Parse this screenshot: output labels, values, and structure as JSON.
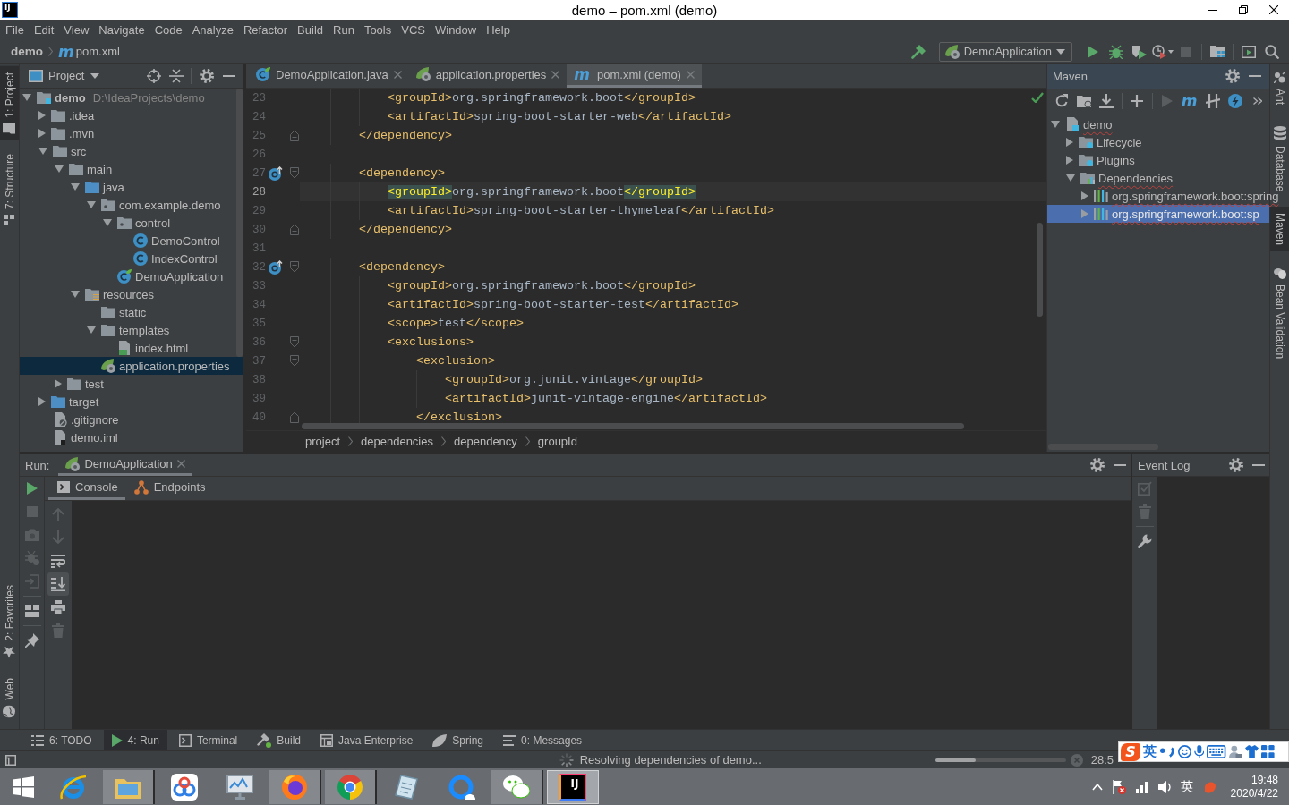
{
  "window": {
    "app_logo": "IJ",
    "title": "demo – pom.xml (demo)"
  },
  "menu": [
    "File",
    "Edit",
    "View",
    "Navigate",
    "Code",
    "Analyze",
    "Refactor",
    "Build",
    "Run",
    "Tools",
    "VCS",
    "Window",
    "Help"
  ],
  "nav_bar": {
    "project": "demo",
    "file_icon": "m",
    "file": "pom.xml"
  },
  "toolbar": {
    "build": {
      "disabled": false
    },
    "run_config": "DemoApplication",
    "groups": [
      [
        {
          "kind": "run",
          "disabled": false
        },
        {
          "kind": "debug",
          "disabled": false
        },
        {
          "kind": "coverage",
          "disabled": false
        },
        {
          "kind": "profile",
          "disabled": false
        },
        {
          "kind": "stop",
          "disabled": true
        }
      ],
      [
        {
          "kind": "project_structure",
          "disabled": false
        }
      ],
      [
        {
          "kind": "presentation",
          "disabled": false
        },
        {
          "kind": "search",
          "disabled": false
        }
      ]
    ]
  },
  "left_stripe": {
    "top": [
      {
        "label": "1: Project",
        "kind": "project",
        "selected": true
      },
      {
        "label": "7: Structure",
        "kind": "structure",
        "selected": false
      }
    ],
    "bottom": [
      {
        "label": "2: Favorites",
        "kind": "favorites",
        "selected": false
      },
      {
        "label": "Web",
        "kind": "web",
        "selected": false
      }
    ]
  },
  "project_panel": {
    "title": "Project",
    "tree": [
      {
        "label": "demo",
        "path": "D:\\IdeaProjects\\demo",
        "kind": "module",
        "expanded": true,
        "selected": false,
        "children": [
          {
            "label": ".idea",
            "kind": "folder",
            "expanded": false,
            "selected": false
          },
          {
            "label": ".mvn",
            "kind": "folder",
            "expanded": false,
            "selected": false
          },
          {
            "label": "src",
            "kind": "folder",
            "expanded": true,
            "selected": false,
            "children": [
              {
                "label": "main",
                "kind": "folder",
                "expanded": true,
                "selected": false,
                "children": [
                  {
                    "label": "java",
                    "kind": "source_folder",
                    "expanded": true,
                    "selected": false,
                    "children": [
                      {
                        "label": "com.example.demo",
                        "kind": "package",
                        "expanded": true,
                        "selected": false,
                        "children": [
                          {
                            "label": "control",
                            "kind": "package",
                            "expanded": true,
                            "selected": false,
                            "children": [
                              {
                                "label": "DemoControl",
                                "kind": "class",
                                "selected": false
                              },
                              {
                                "label": "IndexControl",
                                "kind": "class",
                                "selected": false
                              }
                            ]
                          },
                          {
                            "label": "DemoApplication",
                            "kind": "spring_class",
                            "selected": false
                          }
                        ]
                      }
                    ]
                  },
                  {
                    "label": "resources",
                    "kind": "resource_folder",
                    "expanded": true,
                    "selected": false,
                    "children": [
                      {
                        "label": "static",
                        "kind": "folder",
                        "selected": false
                      },
                      {
                        "label": "templates",
                        "kind": "folder",
                        "expanded": true,
                        "selected": false,
                        "children": [
                          {
                            "label": "index.html",
                            "kind": "html",
                            "selected": false
                          }
                        ]
                      },
                      {
                        "label": "application.properties",
                        "kind": "properties",
                        "selected": true
                      }
                    ]
                  }
                ]
              },
              {
                "label": "test",
                "kind": "folder",
                "expanded": false,
                "selected": false
              }
            ]
          },
          {
            "label": "target",
            "kind": "output_folder",
            "expanded": false,
            "selected": false
          },
          {
            "label": ".gitignore",
            "kind": "ignore_file",
            "selected": false
          },
          {
            "label": "demo.iml",
            "kind": "module_file",
            "selected": false
          }
        ]
      }
    ]
  },
  "editor": {
    "tabs": [
      {
        "label": "DemoApplication.java",
        "kind": "spring_class",
        "selected": false
      },
      {
        "label": "application.properties",
        "kind": "properties",
        "selected": false
      },
      {
        "label": "pom.xml (demo)",
        "kind": "maven",
        "icon_text": "m",
        "selected": true
      }
    ],
    "lines": [
      {
        "number": "23",
        "kind": "plain",
        "text": "            <groupId>org.springframework.boot</groupId>",
        "current": false,
        "gutter_icon": false
      },
      {
        "number": "24",
        "kind": "plain",
        "text": "            <artifactId>spring-boot-starter-web</artifactId>",
        "current": false,
        "gutter_icon": false
      },
      {
        "number": "25",
        "kind": "fold_end",
        "text": "        </dependency>",
        "current": false,
        "gutter_icon": false
      },
      {
        "number": "26",
        "kind": "plain",
        "current": false,
        "gutter_icon": false
      },
      {
        "number": "27",
        "kind": "fold_start",
        "text": "        <dependency>",
        "current": false,
        "gutter_icon": true
      },
      {
        "number": "28",
        "kind": "plain",
        "text": "            <groupId>org.springframework.boot</groupId>",
        "current": true,
        "gutter_icon": false
      },
      {
        "number": "29",
        "kind": "plain",
        "text": "            <artifactId>spring-boot-starter-thymeleaf</artifactId>",
        "current": false,
        "gutter_icon": false
      },
      {
        "number": "30",
        "kind": "fold_end",
        "text": "        </dependency>",
        "current": false,
        "gutter_icon": false
      },
      {
        "number": "31",
        "kind": "plain",
        "current": false,
        "gutter_icon": false
      },
      {
        "number": "32",
        "kind": "fold_start",
        "text": "        <dependency>",
        "current": false,
        "gutter_icon": true
      },
      {
        "number": "33",
        "kind": "plain",
        "text": "            <groupId>org.springframework.boot</groupId>",
        "current": false,
        "gutter_icon": false
      },
      {
        "number": "34",
        "kind": "plain",
        "text": "            <artifactId>spring-boot-starter-test</artifactId>",
        "current": false,
        "gutter_icon": false
      },
      {
        "number": "35",
        "kind": "plain",
        "text": "            <scope>test</scope>",
        "current": false,
        "gutter_icon": false
      },
      {
        "number": "36",
        "kind": "fold_start",
        "text": "            <exclusions>",
        "current": false,
        "gutter_icon": false
      },
      {
        "number": "37",
        "kind": "fold_start",
        "text": "                <exclusion>",
        "current": false,
        "gutter_icon": false
      },
      {
        "number": "38",
        "kind": "plain",
        "text": "                    <groupId>org.junit.vintage</groupId>",
        "current": false,
        "gutter_icon": false
      },
      {
        "number": "39",
        "kind": "plain",
        "text": "                    <artifactId>junit-vintage-engine</artifactId>",
        "current": false,
        "gutter_icon": false
      },
      {
        "number": "40",
        "kind": "fold_end",
        "text": "                </exclusion>",
        "current": false,
        "gutter_icon": false
      }
    ],
    "breadcrumbs": [
      "project",
      "dependencies",
      "dependency",
      "groupId"
    ]
  },
  "maven_panel": {
    "title": "Maven",
    "toolbar": [
      [
        {
          "kind": "refresh",
          "disabled": false
        },
        {
          "kind": "generate",
          "disabled": false
        },
        {
          "kind": "download",
          "disabled": false
        }
      ],
      [
        {
          "kind": "add",
          "disabled": false
        }
      ],
      [
        {
          "kind": "run",
          "disabled": true
        },
        {
          "kind": "execute_goal",
          "text": "m",
          "disabled": false
        },
        {
          "kind": "skip_tests",
          "disabled": false
        },
        {
          "kind": "offline",
          "disabled": false
        },
        {
          "kind": "more",
          "disabled": false
        }
      ]
    ],
    "tree": [
      {
        "label": "demo",
        "kind": "project",
        "expanded": true,
        "selected": false,
        "error": true,
        "children": [
          {
            "label": "Lifecycle",
            "kind": "lifecycle",
            "expanded": false,
            "selected": false,
            "error": false
          },
          {
            "label": "Plugins",
            "kind": "plugins",
            "expanded": false,
            "selected": false,
            "error": false
          },
          {
            "label": "Dependencies",
            "kind": "dependencies",
            "expanded": true,
            "selected": false,
            "error": true,
            "children": [
              {
                "label": "org.springframework.boot:spring",
                "kind": "library",
                "expanded": false,
                "selected": false,
                "error": true
              },
              {
                "label": "org.springframework.boot:sp",
                "kind": "library",
                "expanded": false,
                "selected": true,
                "error": true
              }
            ]
          }
        ]
      }
    ]
  },
  "right_stripe": [
    {
      "label": "Ant",
      "kind": "ant",
      "selected": false
    },
    {
      "label": "Database",
      "kind": "database",
      "selected": false
    },
    {
      "label": "Maven",
      "kind": "maven",
      "selected": true
    },
    {
      "label": "Bean Validation",
      "kind": "bean_validation",
      "selected": false
    }
  ],
  "run_panel": {
    "label": "Run:",
    "tabs": [
      {
        "label": "DemoApplication",
        "selected": true
      }
    ],
    "toolbar": [
      [
        {
          "kind": "rerun",
          "disabled": false
        },
        {
          "kind": "stop",
          "disabled": true
        },
        {
          "kind": "camera",
          "disabled": true
        },
        {
          "kind": "debug_settings",
          "disabled": true
        },
        {
          "kind": "exit",
          "disabled": true
        }
      ],
      [
        {
          "kind": "layout",
          "disabled": false
        }
      ],
      [
        {
          "kind": "pin",
          "disabled": false
        }
      ]
    ],
    "side_toolbar": [
      {
        "kind": "up",
        "disabled": true,
        "on": false
      },
      {
        "kind": "down",
        "disabled": true,
        "on": false
      },
      {
        "kind": "wrap",
        "disabled": false,
        "on": false
      },
      {
        "kind": "scroll_end",
        "disabled": false,
        "on": true
      },
      {
        "kind": "print",
        "disabled": false,
        "on": false
      },
      {
        "kind": "trash",
        "disabled": true,
        "on": false
      }
    ],
    "console_tabs": [
      {
        "label": "Console",
        "kind": "console",
        "selected": true
      },
      {
        "label": "Endpoints",
        "kind": "endpoints",
        "selected": false
      }
    ]
  },
  "event_log": {
    "title": "Event Log",
    "toolbar": [
      [
        {
          "kind": "mark_read",
          "disabled": true
        },
        {
          "kind": "trash",
          "disabled": true
        }
      ],
      [
        {
          "kind": "wrench",
          "disabled": false
        }
      ]
    ]
  },
  "tool_window_bar": [
    {
      "label": "6: TODO",
      "kind": "todo",
      "selected": false
    },
    {
      "label": "4: Run",
      "kind": "run",
      "selected": true
    },
    {
      "label": "Terminal",
      "kind": "terminal",
      "selected": false
    },
    {
      "label": "Build",
      "kind": "build",
      "selected": false
    },
    {
      "label": "Java Enterprise",
      "kind": "java_enterprise",
      "selected": false
    },
    {
      "label": "Spring",
      "kind": "spring",
      "selected": false
    },
    {
      "label": "0: Messages",
      "kind": "messages",
      "selected": false
    }
  ],
  "status_bar": {
    "message": "Resolving dependencies of demo...",
    "progress": {
      "level": 0.31
    },
    "position": "28:5"
  },
  "ime_toolbar": {
    "logo": "S",
    "mode": "英"
  },
  "taskbar": {
    "apps": [
      {
        "kind": "e_ring",
        "running": false,
        "selected": false
      },
      {
        "kind": "folder",
        "running": true,
        "selected": false
      },
      {
        "kind": "cloud",
        "running": false,
        "selected": false
      },
      {
        "kind": "monitor",
        "running": false,
        "selected": false
      },
      {
        "kind": "flame_globe",
        "running": true,
        "selected": false
      },
      {
        "kind": "segmented_circle",
        "running": true,
        "selected": false
      },
      {
        "kind": "notepad",
        "running": false,
        "selected": false
      },
      {
        "kind": "ring_cloud",
        "running": false,
        "selected": false
      },
      {
        "kind": "chat_bubbles",
        "running": true,
        "selected": false
      },
      {
        "kind": "ij_tile",
        "text": "IJ",
        "running": true,
        "selected": true
      }
    ],
    "tray": {
      "ime": "英",
      "time": "19:48",
      "date": "2020/4/22"
    }
  }
}
